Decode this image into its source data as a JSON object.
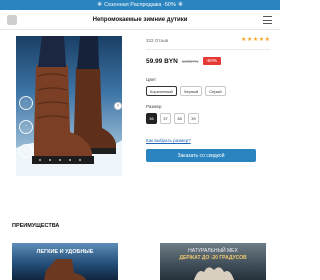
{
  "promo": {
    "text": "Сезонная Распродажа -50%",
    "icon": "snowflake-icon"
  },
  "header": {
    "title": "Непромокаемые зимние дутики"
  },
  "product": {
    "reviews": "322 Отзыв",
    "rating": 5,
    "rating_max": 5,
    "price": "59.99 BYN",
    "old_price": "120BYN",
    "discount": "-50%",
    "color_label": "Цвет",
    "colors": [
      "Коричневый",
      "Черный",
      "Серый"
    ],
    "selected_color": "Коричневый",
    "size_label": "Размер",
    "sizes": [
      "36",
      "37",
      "38",
      "39"
    ],
    "selected_size": "36",
    "size_guide": "Как выбрать размер?",
    "order_button": "Заказать со скидкой"
  },
  "benefits": {
    "heading": "ПРЕИМУЩЕСТВА",
    "cards": [
      {
        "line1": "ЛЕГКИЕ И УДОБНЫЕ",
        "line2": ""
      },
      {
        "line1": "НАТУРАЛЬНЫЙ МЕХ",
        "line2": "ДЕРЖАТ ДО -20 ГРАДУСОВ"
      }
    ]
  },
  "colors": {
    "accent": "#2a84bf",
    "discount": "#e53935",
    "star": "#f5a623",
    "boot": "#7a3f24"
  }
}
